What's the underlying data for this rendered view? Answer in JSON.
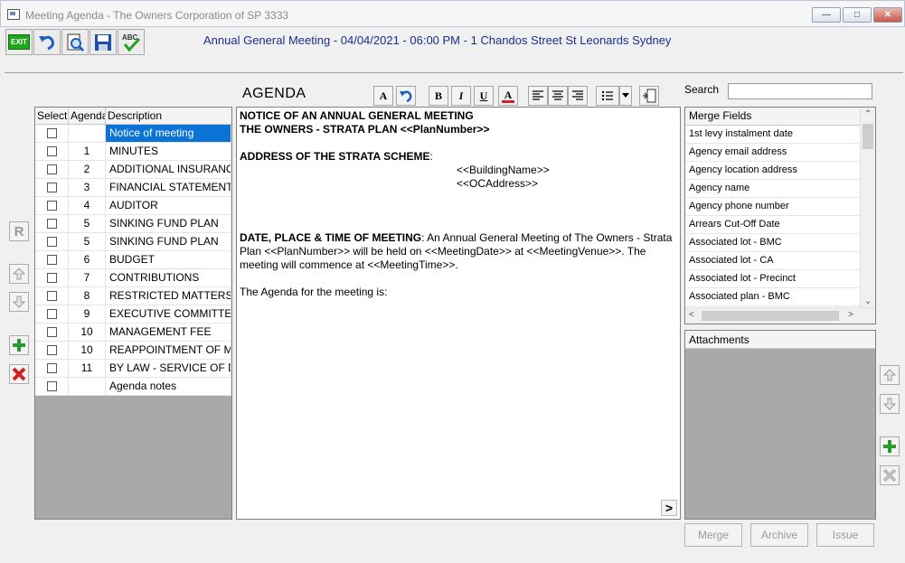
{
  "window": {
    "title": "Meeting Agenda - The Owners Corporation of SP 3333"
  },
  "toolbar": {
    "exit_label": "EXIT",
    "spell_label": "ABC"
  },
  "meeting": {
    "title": "Annual General Meeting - 04/04/2021 - 06:00 PM - 1 Chandos Street St Leonards Sydney"
  },
  "side_buttons": {
    "r_label": "R"
  },
  "agenda_grid": {
    "headers": [
      "Select",
      "Agenda",
      "Description"
    ],
    "rows": [
      {
        "agenda": "",
        "description": "Notice of meeting",
        "selected": true
      },
      {
        "agenda": "1",
        "description": "MINUTES"
      },
      {
        "agenda": "2",
        "description": "ADDITIONAL INSURANCE"
      },
      {
        "agenda": "3",
        "description": "FINANCIAL STATEMENTS"
      },
      {
        "agenda": "4",
        "description": "AUDITOR"
      },
      {
        "agenda": "5",
        "description": "SINKING FUND PLAN"
      },
      {
        "agenda": "5",
        "description": "SINKING FUND PLAN"
      },
      {
        "agenda": "6",
        "description": "BUDGET"
      },
      {
        "agenda": "7",
        "description": "CONTRIBUTIONS"
      },
      {
        "agenda": "8",
        "description": "RESTRICTED MATTERS"
      },
      {
        "agenda": "9",
        "description": "EXECUTIVE COMMITTEE"
      },
      {
        "agenda": "10",
        "description": "MANAGEMENT FEE"
      },
      {
        "agenda": "10",
        "description": "REAPPOINTMENT OF MAI"
      },
      {
        "agenda": "11",
        "description": "BY LAW - SERVICE OF DO"
      },
      {
        "agenda": "",
        "description": "Agenda notes"
      }
    ]
  },
  "editor": {
    "heading": "AGENDA",
    "format_buttons": [
      "A",
      "B",
      "I",
      "U",
      "A"
    ],
    "line1": "NOTICE OF AN ANNUAL GENERAL MEETING",
    "line2": "THE OWNERS - STRATA PLAN <<PlanNumber>>",
    "address_heading": "ADDRESS OF THE STRATA SCHEME",
    "address_colon": ":",
    "building": "<<BuildingName>>",
    "oc_address": "<<OCAddress>>",
    "date_heading": "DATE, PLACE & TIME OF MEETING",
    "date_text": ": An Annual General Meeting of The Owners - Strata Plan <<PlanNumber>> will be held on <<MeetingDate>> at <<MeetingVenue>>. The meeting will commence at <<MeetingTime>>.",
    "agenda_intro": "The Agenda for the meeting is:",
    "more_label": ">"
  },
  "search": {
    "label": "Search",
    "value": ""
  },
  "merge_fields": {
    "header": "Merge Fields",
    "items": [
      "1st levy instalment date",
      "Agency email address",
      "Agency location address",
      "Agency name",
      "Agency phone number",
      "Arrears Cut-Off Date",
      "Associated lot - BMC",
      "Associated lot - CA",
      "Associated lot - Precinct",
      "Associated plan - BMC"
    ]
  },
  "attachments": {
    "header": "Attachments"
  },
  "actions": {
    "merge": "Merge",
    "archive": "Archive",
    "issue": "Issue"
  },
  "colors": {
    "selection": "#0c73d6",
    "meeting_title": "#1a2f8a",
    "add_green": "#2a9a2a",
    "delete_red": "#d42020"
  }
}
